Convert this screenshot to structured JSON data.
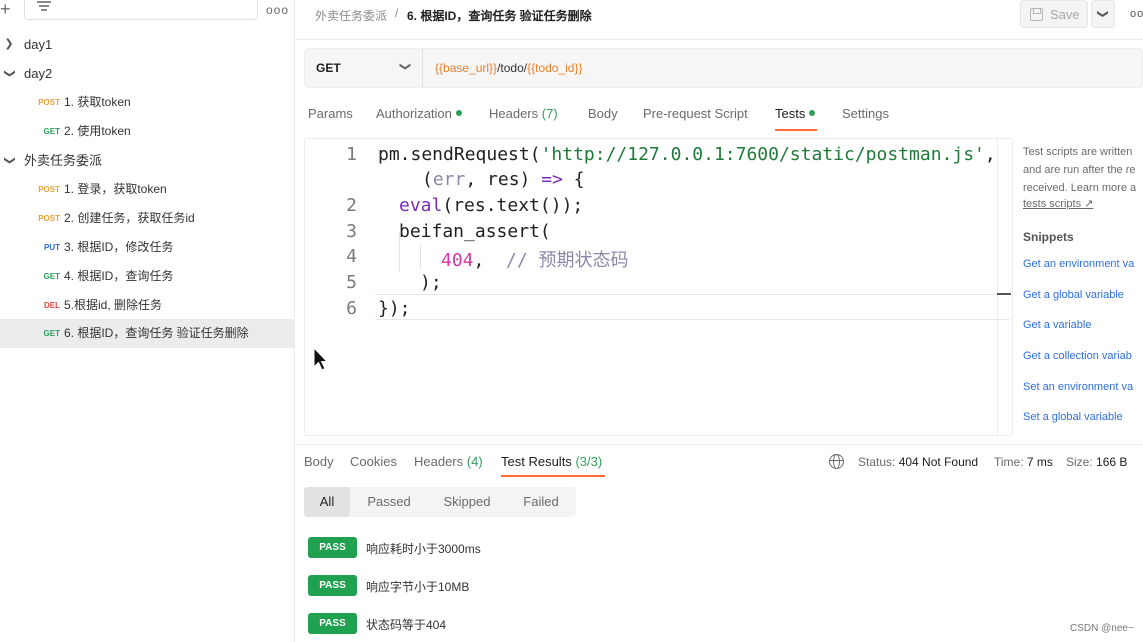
{
  "sidebar": {
    "more_label": "ooo",
    "folders": [
      {
        "name": "day1",
        "expanded": false
      },
      {
        "name": "day2",
        "expanded": true,
        "requests": [
          {
            "method": "POST",
            "name": "1. 获取token"
          },
          {
            "method": "GET",
            "name": "2. 使用token"
          }
        ]
      },
      {
        "name": "外卖任务委派",
        "expanded": true,
        "requests": [
          {
            "method": "POST",
            "name": "1. 登录，获取token"
          },
          {
            "method": "POST",
            "name": "2. 创建任务，获取任务id"
          },
          {
            "method": "PUT",
            "name": "3. 根据ID，修改任务"
          },
          {
            "method": "GET",
            "name": "4. 根据ID，查询任务"
          },
          {
            "method": "DEL",
            "name": "5.根据id, 删除任务"
          },
          {
            "method": "GET",
            "name": "6. 根据ID，查询任务 验证任务删除",
            "selected": true
          }
        ]
      }
    ]
  },
  "header": {
    "breadcrumb_parent": "外卖任务委派",
    "breadcrumb_sep": "/",
    "breadcrumb_current": "6. 根据ID，查询任务 验证任务删除",
    "save_label": "Save",
    "more_label": "oo"
  },
  "request": {
    "method": "GET",
    "url_var1": "{{base_url}}",
    "url_mid": "/todo/",
    "url_var2": "{{todo_id}}"
  },
  "tabs": {
    "params": "Params",
    "authorization": "Authorization",
    "headers": "Headers",
    "headers_count": "(7)",
    "body": "Body",
    "prerequest": "Pre-request Script",
    "tests": "Tests",
    "settings": "Settings",
    "active": "Tests"
  },
  "editor": {
    "line_numbers": [
      "1",
      "2",
      "3",
      "4",
      "5",
      "6"
    ],
    "l1_a": "pm.sendRequest(",
    "l1_str": "'http://127.0.0.1:7600/static/postman.js'",
    "l1_b": ",",
    "l1c_a": "(",
    "l1c_err": "err",
    "l1c_b": ", res) ",
    "l1c_arrow": "=>",
    "l1c_c": " {",
    "l2_kw": "eval",
    "l2_rest": "(res.text());",
    "l3": "beifan_assert(",
    "l4_num": "404",
    "l4_comma": ",",
    "l4_cmt": "// 预期状态码",
    "l5": ");",
    "l6": "});"
  },
  "right_panel": {
    "desc_lines": [
      "Test scripts are written",
      "and are run after the re",
      "received. Learn more a"
    ],
    "link": "tests scripts ↗",
    "snippets_title": "Snippets",
    "snippets": [
      "Get an environment va",
      "Get a global variable",
      "Get a variable",
      "Get a collection variab",
      "Set an environment va",
      "Set a global variable"
    ]
  },
  "response": {
    "tabs": {
      "body": "Body",
      "cookies": "Cookies",
      "headers": "Headers",
      "headers_count": "(4)",
      "test_results": "Test Results",
      "test_results_count": "(3/3)"
    },
    "status_label": "Status:",
    "status_value": "404 Not Found",
    "time_label": "Time:",
    "time_value": "7 ms",
    "size_label": "Size:",
    "size_value": "166 B",
    "filters": [
      "All",
      "Passed",
      "Skipped",
      "Failed"
    ],
    "active_filter": "All",
    "results": [
      {
        "status": "PASS",
        "name": "响应耗时小于3000ms"
      },
      {
        "status": "PASS",
        "name": "响应字节小于10MB"
      },
      {
        "status": "PASS",
        "name": "状态码等于404"
      }
    ]
  },
  "watermark": "CSDN @nee~",
  "colors": {
    "accent": "#ff6c37",
    "pass_green": "#1fa150",
    "post": "#e8a23a",
    "get": "#2f9e5a",
    "put": "#2f6fe0",
    "delete": "#e0483b",
    "link_blue": "#2f6fe0",
    "url_variable": "#e8802a"
  }
}
